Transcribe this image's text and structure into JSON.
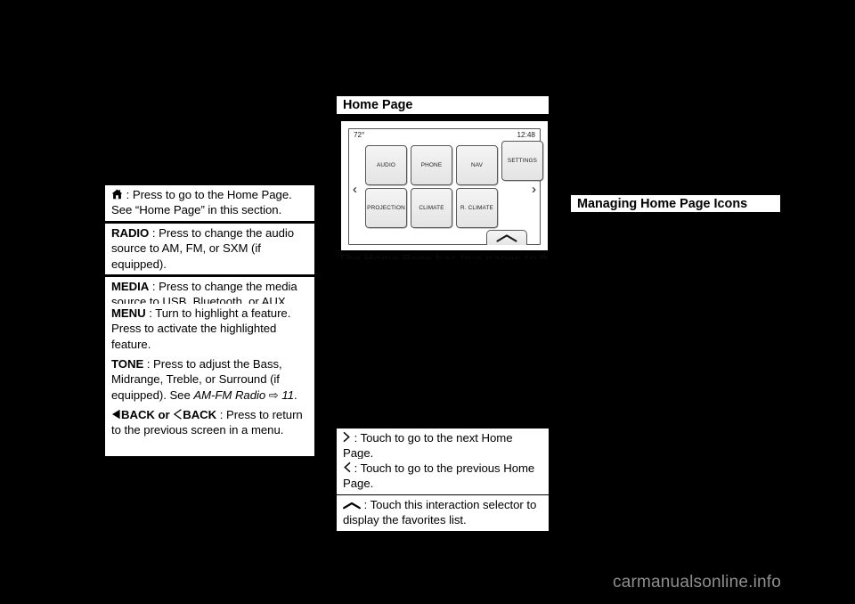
{
  "page": {
    "background_color": "#000000",
    "text_color": "#000000",
    "panel_color": "#ffffff"
  },
  "left_column": {
    "entries": [
      {
        "icon": "home-icon",
        "bold_label": "",
        "text": " : Press to go to the Home Page. See “Home Page” in this section."
      },
      {
        "icon": "",
        "bold_label": "RADIO",
        "text": " : Press to change the audio source to AM, FM, or SXM (if equipped)."
      },
      {
        "icon": "",
        "bold_label": "MEDIA",
        "text": " : Press to change the media source to USB, Bluetooth, or AUX."
      },
      {
        "icon": "",
        "bold_label": "MENU",
        "text": " : Turn to highlight a feature. Press to activate the highlighted feature."
      },
      {
        "icon": "",
        "bold_label": "TONE",
        "text_before": " : Press to adjust the Bass, Midrange, Treble, or Surround (if equipped). See ",
        "italic_ref": "AM-FM Radio",
        "page_arrow": "⇨",
        "page_number": "11",
        "text_after": "."
      },
      {
        "icon": "back-triangle-icon",
        "bold_label": "BACK or",
        "icon2": "back-chevron-icon",
        "bold_label2": "BACK",
        "text": " : Press to return to the previous screen in a menu."
      }
    ]
  },
  "middle_column": {
    "heading": "Home Page",
    "figure": {
      "name": "home-page-touchscreen-illustration",
      "status_bar": {
        "temperature": "72°",
        "clock": "12:48"
      },
      "tiles_row_1": [
        "AUDIO",
        "PHONE",
        "NAV",
        "SETTINGS"
      ],
      "tiles_row_2": [
        "PROJECTION",
        "CLIMATE",
        "R. CLIMATE"
      ],
      "pager_previous": "‹",
      "pager_next": "›",
      "favorites_tab": "caret-up-icon"
    },
    "obscured_caption": "The Home Page has two pages to hold",
    "entries": [
      {
        "icon": "chevron-right-icon",
        "text": " : Touch to go to the next Home Page."
      },
      {
        "icon": "chevron-left-icon",
        "text": " : Touch to go to the previous Home Page."
      },
      {
        "icon": "caret-up-icon",
        "text": " : Touch this interaction selector to display the favorites list."
      }
    ]
  },
  "right_column": {
    "heading": "Managing Home Page Icons"
  },
  "watermark": {
    "text": "carmanualsonline.info",
    "color": "#8f8f8f"
  }
}
